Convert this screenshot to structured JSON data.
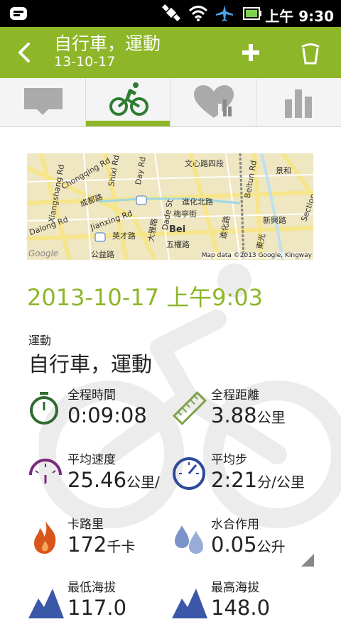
{
  "status_bar": {
    "time": "上午 9:30"
  },
  "app_bar": {
    "title": "自行車，運動",
    "subtitle": "13-10-17"
  },
  "tabs": [
    {
      "icon": "comment-icon"
    },
    {
      "icon": "bicycle-icon",
      "selected": true
    },
    {
      "icon": "heart-chart-icon"
    },
    {
      "icon": "bar-chart-icon"
    }
  ],
  "map": {
    "attribution": "Map data ©2013 Google, Kingway",
    "logo": "Google",
    "labels": [
      "文心路四段",
      "Beitun Rd",
      "景和",
      "Chongqing Rd",
      "Shixi Rd",
      "Day Rd",
      "成都路",
      "進化北路",
      "梅亭街",
      "新興路",
      "Jianxing Rd",
      "Dade St",
      "英才路",
      "大雅路",
      "Bei",
      "進化路",
      "五權路",
      "公益路",
      "Section",
      "Dalong Rd",
      "東光",
      "Xiangshang Rd"
    ]
  },
  "workout": {
    "datetime": "2013-10-17 上午9:03",
    "sport_label": "運動",
    "sport_value": "自行車，運動"
  },
  "stats": [
    {
      "label": "全程時間",
      "value": "0:09:08",
      "unit": "",
      "icon": "stopwatch-icon"
    },
    {
      "label": "全程距離",
      "value": "3.88",
      "unit": "公里",
      "icon": "ruler-icon"
    },
    {
      "label": "平均速度",
      "value": "25.46",
      "unit": "公里/",
      "icon": "speedometer-icon"
    },
    {
      "label": "平均步",
      "value": "2:21",
      "unit": "分/公里",
      "icon": "gauge-icon"
    },
    {
      "label": "卡路里",
      "value": "172",
      "unit": "千卡",
      "icon": "flame-icon"
    },
    {
      "label": "水合作用",
      "value": "0.05",
      "unit": "公升",
      "icon": "water-drops-icon"
    },
    {
      "label": "最低海拔",
      "value": "117.0",
      "unit": "",
      "icon": "mountain-icon"
    },
    {
      "label": "最高海拔",
      "value": "148.0",
      "unit": "",
      "icon": "mountain-icon"
    }
  ],
  "colors": {
    "accent": "#8db628",
    "status_bar": "#000000"
  }
}
